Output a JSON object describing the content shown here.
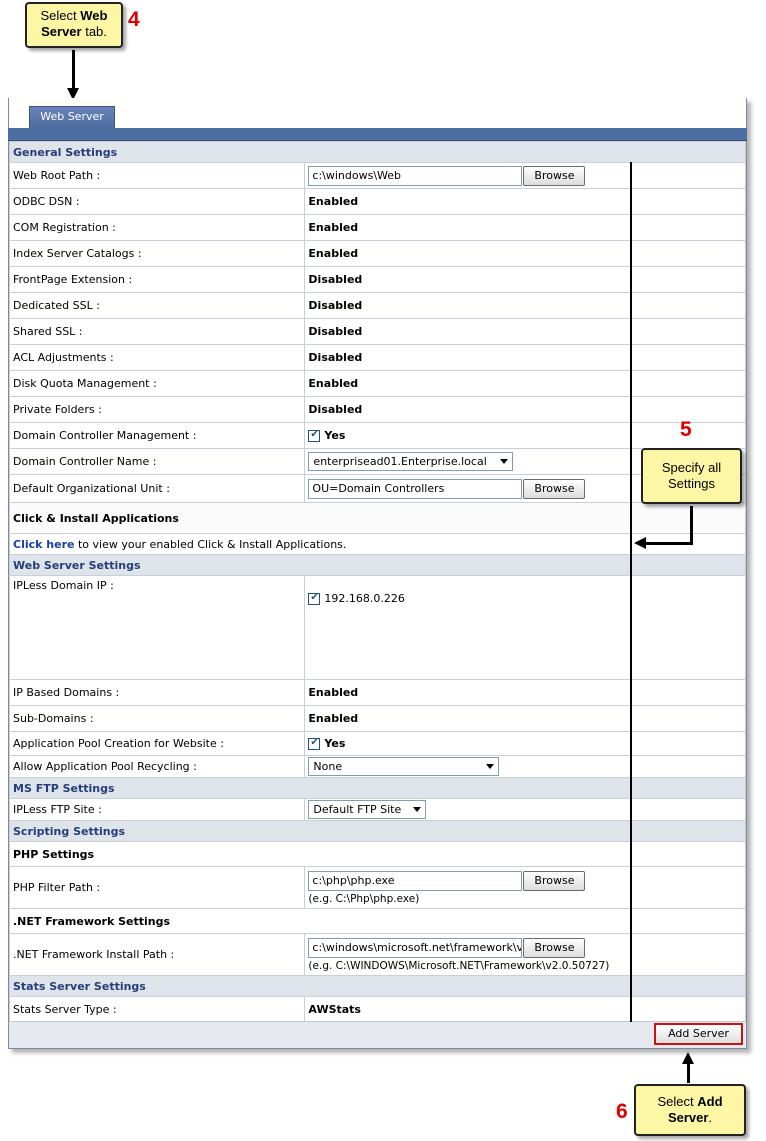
{
  "callouts": {
    "step4": {
      "num": "4",
      "pre": "Select ",
      "bold": "Web Server",
      "post": " tab."
    },
    "step5": {
      "num": "5",
      "text": "Specify all Settings"
    },
    "step6": {
      "num": "6",
      "pre": "Select ",
      "bold": "Add Server",
      "post": "."
    }
  },
  "tab": {
    "label": "Web Server"
  },
  "sections": {
    "general": "General Settings",
    "web_server": "Web Server Settings",
    "ms_ftp": "MS FTP Settings",
    "scripting": "Scripting Settings",
    "stats": "Stats Server Settings"
  },
  "general": {
    "web_root_label": "Web Root Path :",
    "web_root_value": "c:\\windows\\Web",
    "browse": "Browse",
    "odbc_label": "ODBC DSN :",
    "odbc_value": "Enabled",
    "com_label": "COM Registration :",
    "com_value": "Enabled",
    "index_label": "Index Server Catalogs :",
    "index_value": "Enabled",
    "frontpage_label": "FrontPage Extension :",
    "frontpage_value": "Disabled",
    "dedssl_label": "Dedicated SSL :",
    "dedssl_value": "Disabled",
    "sharedssl_label": "Shared SSL :",
    "sharedssl_value": "Disabled",
    "acl_label": "ACL Adjustments :",
    "acl_value": "Disabled",
    "quota_label": "Disk Quota Management :",
    "quota_value": "Enabled",
    "private_label": "Private Folders :",
    "private_value": "Disabled",
    "dcm_label": "Domain Controller Management :",
    "dcm_value": "Yes",
    "dcn_label": "Domain Controller Name :",
    "dcn_value": "enterprisead01.Enterprise.local",
    "ou_label": "Default Organizational Unit :",
    "ou_value": "OU=Domain Controllers",
    "click_install_title": "Click & Install Applications",
    "click_here": "Click here",
    "click_here_rest": " to view your enabled Click & Install Applications."
  },
  "web_server": {
    "ipless_label": "IPLess Domain IP :",
    "ipless_value": "192.168.0.226",
    "ipbased_label": "IP Based Domains :",
    "ipbased_value": "Enabled",
    "subdomains_label": "Sub-Domains :",
    "subdomains_value": "Enabled",
    "apppool_label": "Application Pool Creation for Website :",
    "apppool_value": "Yes",
    "recycle_label": "Allow Application Pool Recycling :",
    "recycle_value": "None"
  },
  "ms_ftp": {
    "ipless_ftp_label": "IPLess FTP Site :",
    "ipless_ftp_value": "Default FTP Site"
  },
  "scripting": {
    "php_title": "PHP Settings",
    "php_label": "PHP Filter Path :",
    "php_value": "c:\\php\\php.exe",
    "php_hint": "(e.g. C:\\Php\\php.exe)",
    "net_title": ".NET Framework Settings",
    "net_label": ".NET Framework Install Path :",
    "net_value": "c:\\windows\\microsoft.net\\framework\\v",
    "net_hint": "(e.g. C:\\WINDOWS\\Microsoft.NET\\Framework\\v2.0.50727)"
  },
  "stats": {
    "type_label": "Stats Server Type :",
    "type_value": "AWStats"
  },
  "footer": {
    "add_server": "Add Server"
  }
}
